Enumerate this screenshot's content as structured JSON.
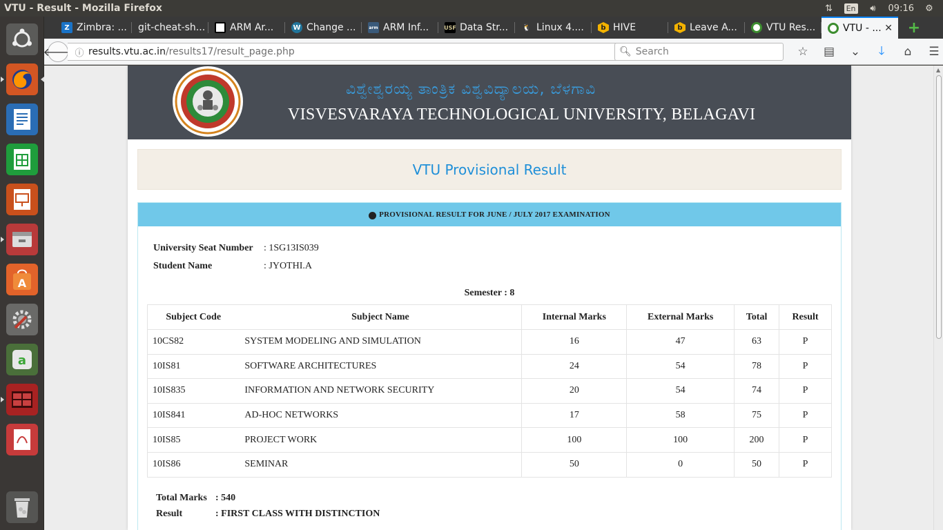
{
  "os": {
    "window_title": "VTU - Result - Mozilla Firefox",
    "keyboard_layout": "En",
    "clock": "09:16"
  },
  "tabs": [
    {
      "label": "Zimbra: ...",
      "icon": "zimbra-icon",
      "color": "#1a73c7"
    },
    {
      "label": "git-cheat-sh...",
      "icon": "blank-icon",
      "color": ""
    },
    {
      "label": "ARM Ar...",
      "icon": "chess-icon",
      "color": "#000000"
    },
    {
      "label": "Change ...",
      "icon": "wordpress-icon",
      "color": "#21759b"
    },
    {
      "label": "ARM Inf...",
      "icon": "arm-icon",
      "color": "#3a5a7a"
    },
    {
      "label": "Data Str...",
      "icon": "usf-icon",
      "color": "#006747"
    },
    {
      "label": "Linux 4....",
      "icon": "tux-icon",
      "color": "#f0c419"
    },
    {
      "label": "HIVE",
      "icon": "hive-icon",
      "color": "#f3b200"
    },
    {
      "label": "Leave A...",
      "icon": "hive-icon",
      "color": "#f3b200"
    },
    {
      "label": "VTU Res...",
      "icon": "vtu-icon",
      "color": "#3c8d2f"
    },
    {
      "label": "VTU - ...",
      "icon": "vtu-icon",
      "color": "#3c8d2f",
      "active": true
    }
  ],
  "navbar": {
    "url_host": "results.vtu.ac.in",
    "url_path": "/results17/result_page.php",
    "search_placeholder": "Search"
  },
  "banner": {
    "kannada_title": "ವಿಶ್ವೇಶ್ವರಯ್ಯ ತಾಂತ್ರಿಕ ವಿಶ್ವವಿದ್ಯಾಲಯ, ಬೆಳಗಾವಿ",
    "english_title": "VISVESVARAYA TECHNOLOGICAL UNIVERSITY, BELAGAVI"
  },
  "result": {
    "page_heading": "VTU Provisional Result",
    "panel_heading": "PROVISIONAL RESULT FOR JUNE / JULY 2017 EXAMINATION",
    "usn_label": "University Seat Number",
    "usn_value": ": 1SG13IS039",
    "name_label": "Student Name",
    "name_value": ": JYOTHI.A",
    "semester": "Semester : 8",
    "columns": [
      "Subject Code",
      "Subject Name",
      "Internal Marks",
      "External Marks",
      "Total",
      "Result"
    ],
    "rows": [
      {
        "code": "10CS82",
        "name": "SYSTEM MODELING AND SIMULATION",
        "internal": "16",
        "external": "47",
        "total": "63",
        "result": "P"
      },
      {
        "code": "10IS81",
        "name": "SOFTWARE ARCHITECTURES",
        "internal": "24",
        "external": "54",
        "total": "78",
        "result": "P"
      },
      {
        "code": "10IS835",
        "name": "INFORMATION AND NETWORK SECURITY",
        "internal": "20",
        "external": "54",
        "total": "74",
        "result": "P"
      },
      {
        "code": "10IS841",
        "name": "AD-HOC NETWORKS",
        "internal": "17",
        "external": "58",
        "total": "75",
        "result": "P"
      },
      {
        "code": "10IS85",
        "name": "PROJECT WORK",
        "internal": "100",
        "external": "100",
        "total": "200",
        "result": "P"
      },
      {
        "code": "10IS86",
        "name": "SEMINAR",
        "internal": "50",
        "external": "0",
        "total": "50",
        "result": "P"
      }
    ],
    "total_label": "Total Marks",
    "total_value": ": 540",
    "result_label": "Result",
    "result_value": ": FIRST CLASS WITH DISTINCTION"
  }
}
